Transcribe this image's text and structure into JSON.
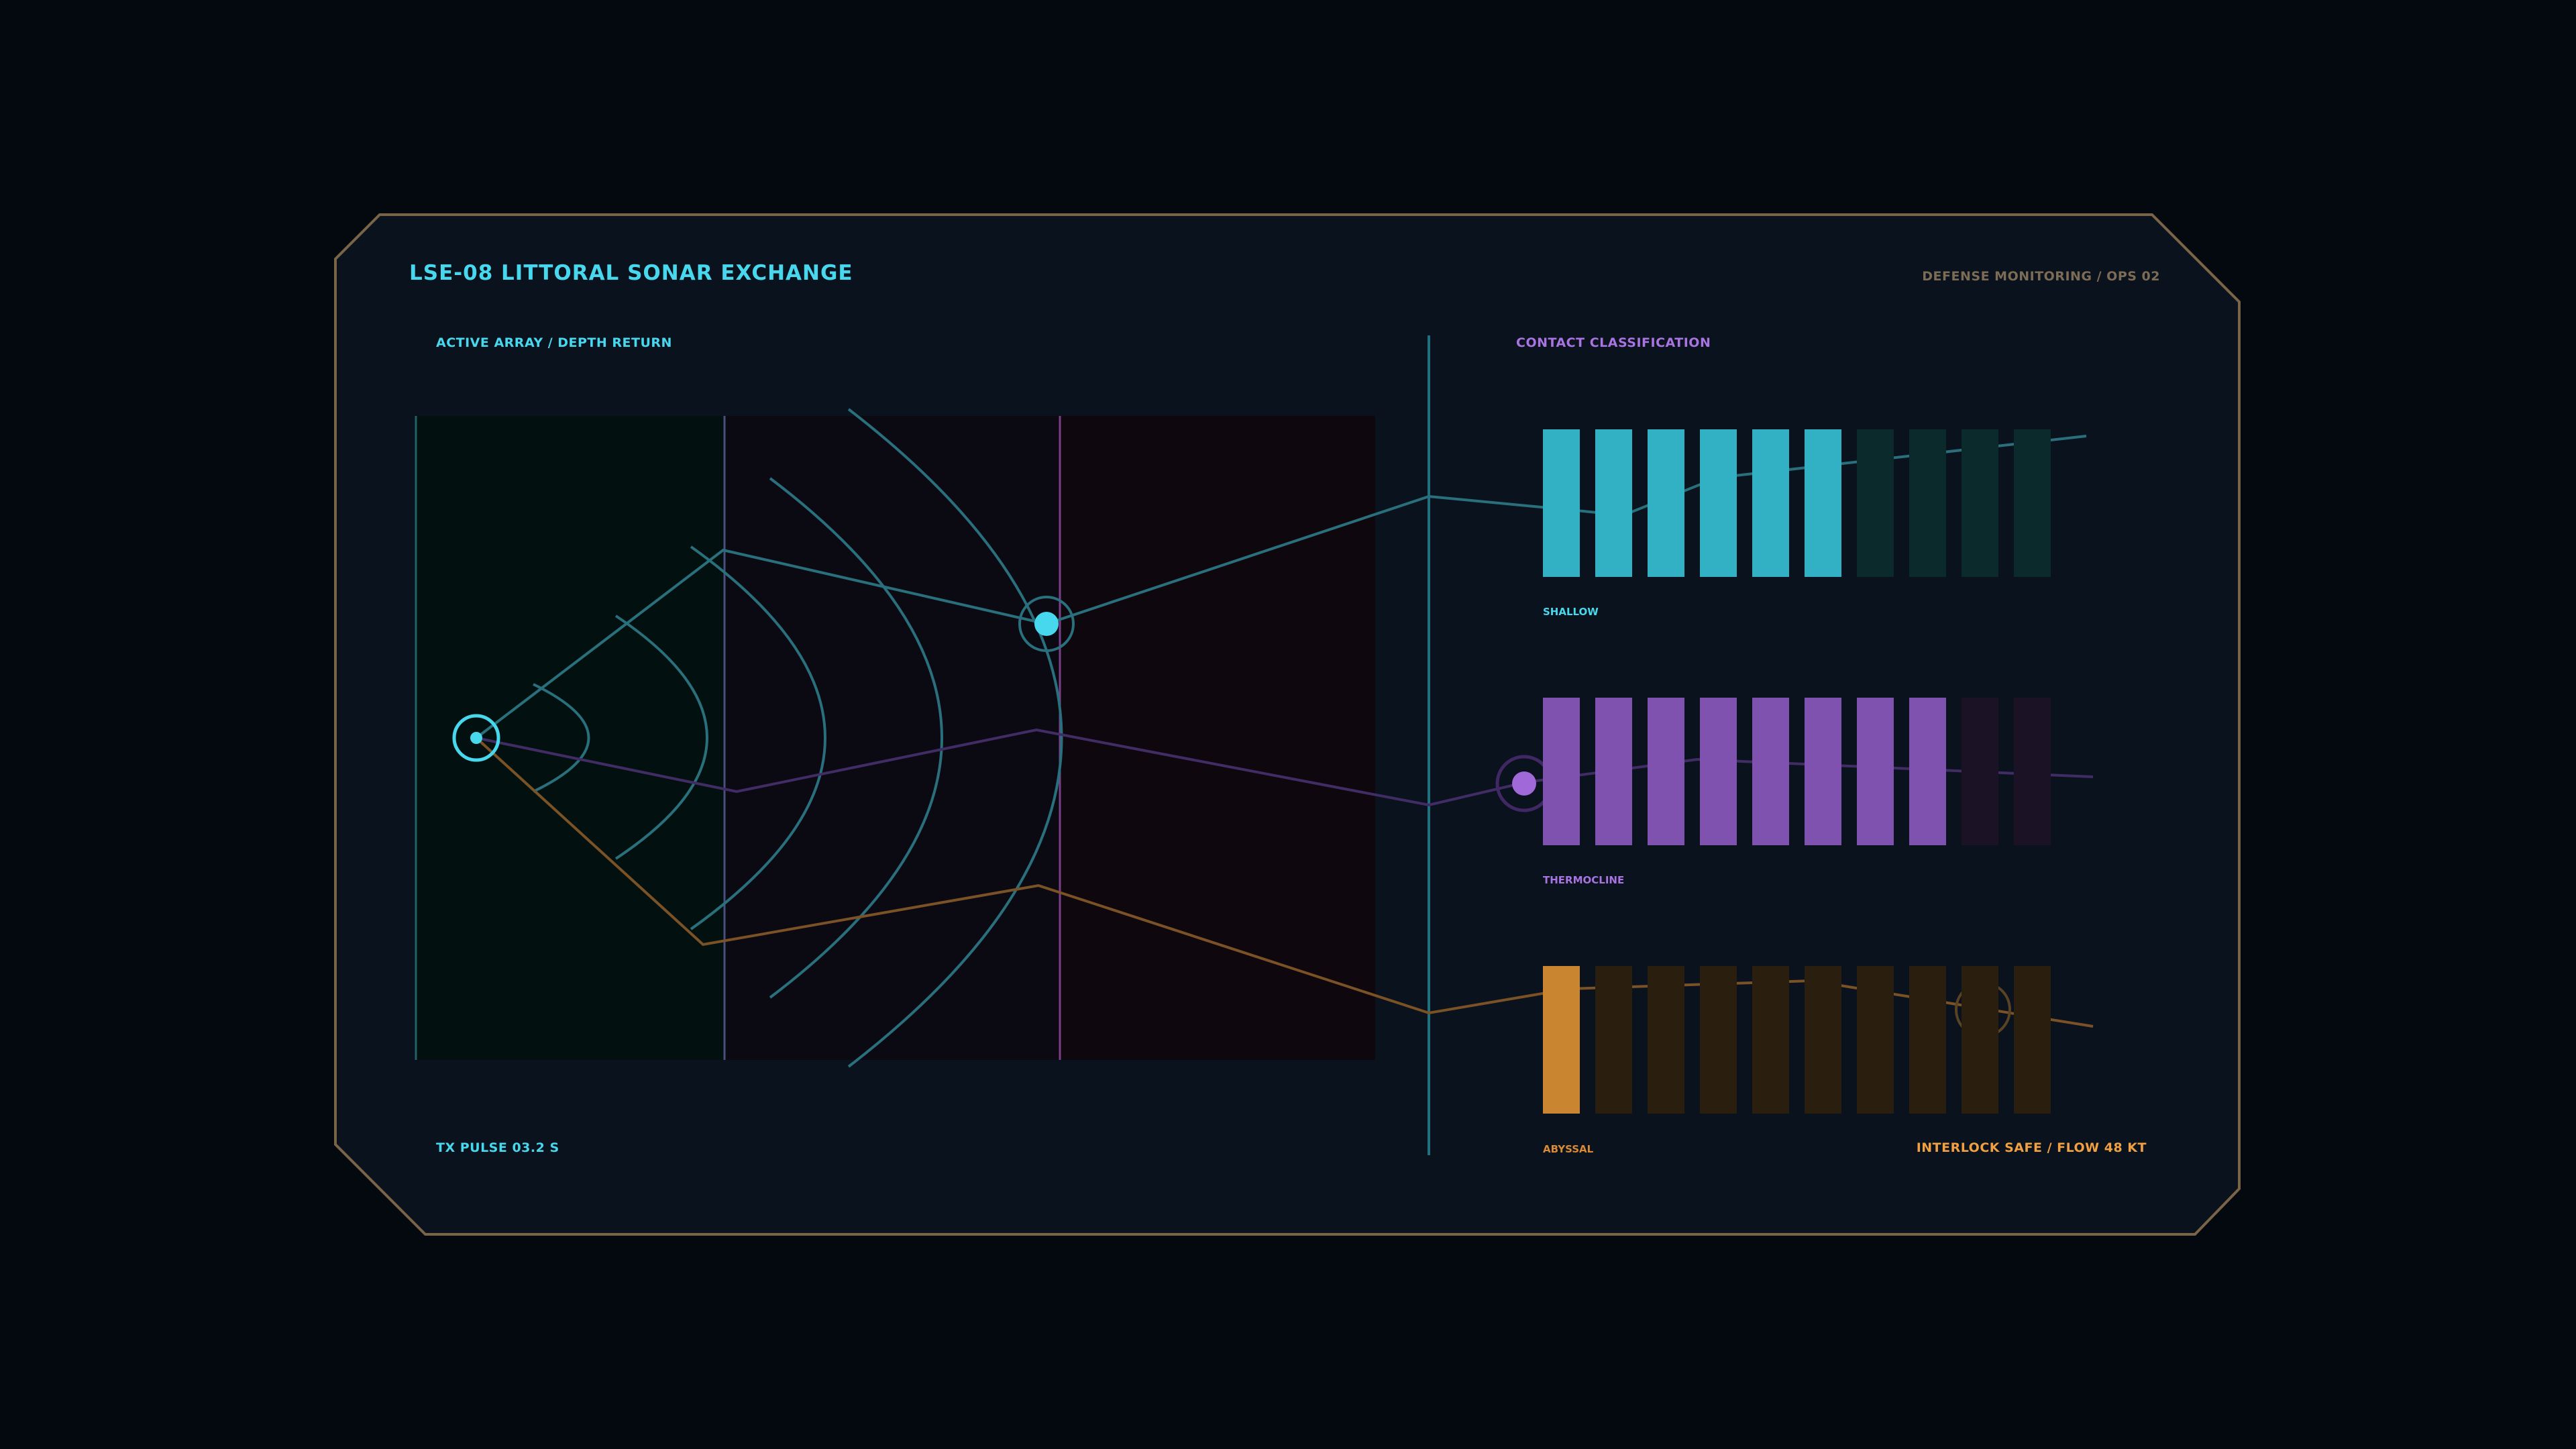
{
  "header": {
    "title": "LSE-08  LITTORAL SONAR EXCHANGE",
    "ops_label": "DEFENSE MONITORING / OPS 02"
  },
  "array_panel": {
    "label": "ACTIVE ARRAY / DEPTH RETURN",
    "pulse_label": "TX PULSE 03.2 S"
  },
  "classification": {
    "label": "CONTACT CLASSIFICATION",
    "bands": [
      {
        "name": "SHALLOW",
        "level": 6,
        "max": 10
      },
      {
        "name": "THERMOCLINE",
        "level": 8,
        "max": 10
      },
      {
        "name": "ABYSSAL",
        "level": 1,
        "max": 10
      }
    ]
  },
  "status": {
    "interlock_label": "INTERLOCK SAFE / FLOW 48 KT"
  },
  "colors": {
    "background": "#04080f",
    "panel": "#0a121d",
    "frame": "#7a6448",
    "cyan": "#48d8ee",
    "teal": "#2a6f7c",
    "purple": "#7f52b0",
    "purple_text": "#a874e0",
    "amber": "#c98530",
    "amber_text": "#f0a040",
    "muted_text": "#7c6c55"
  },
  "icons": {
    "emitter": "sonar-emitter-icon",
    "contact": "contact-marker-icon"
  }
}
